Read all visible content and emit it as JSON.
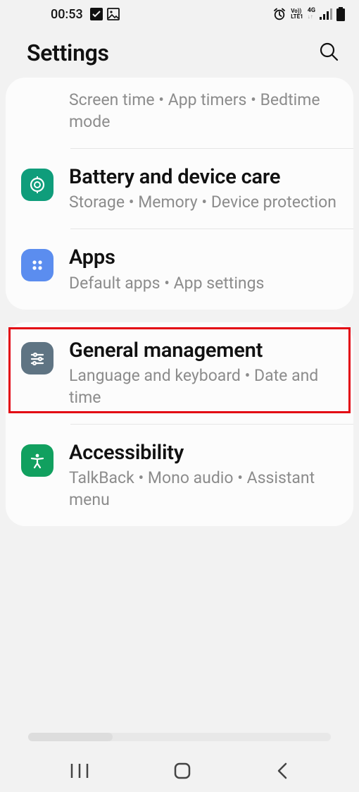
{
  "status": {
    "time": "00:53"
  },
  "header": {
    "title": "Settings"
  },
  "card1": {
    "item0": {
      "sub": "Screen time  •  App timers  •  Bedtime mode"
    },
    "item1": {
      "title": "Battery and device care",
      "sub": "Storage  •  Memory  •  Device protection"
    },
    "item2": {
      "title": "Apps",
      "sub": "Default apps  •  App settings"
    }
  },
  "card2": {
    "item0": {
      "title": "General management",
      "sub": "Language and keyboard  •  Date and time"
    },
    "item1": {
      "title": "Accessibility",
      "sub": "TalkBack  •  Mono audio  •  Assistant menu"
    }
  },
  "icons": {
    "battery_color": "#0f9d7b",
    "apps_color": "#5b8def",
    "general_color": "#5f7483",
    "accessibility_color": "#11a05f"
  }
}
